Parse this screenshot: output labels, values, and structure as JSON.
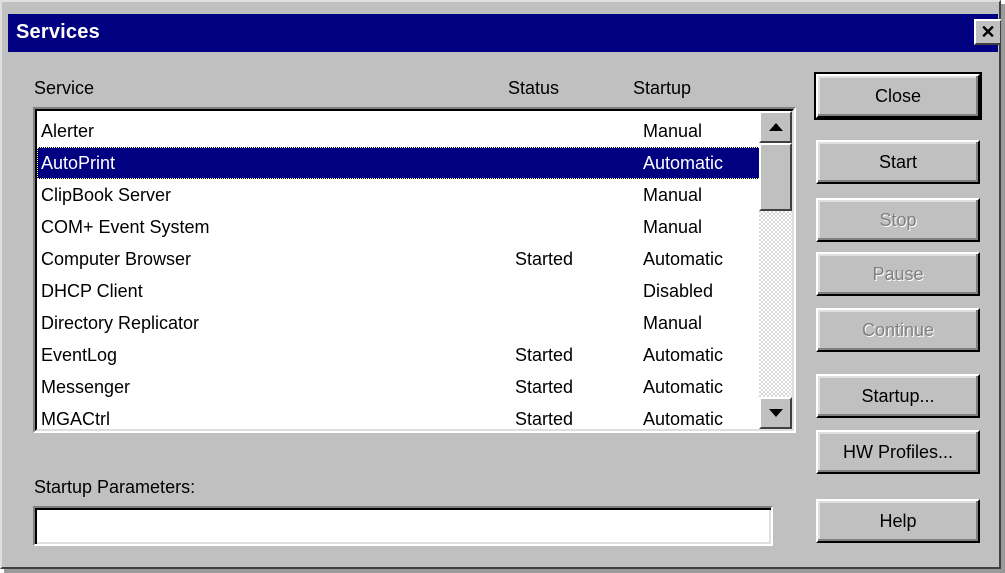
{
  "window": {
    "title": "Services",
    "close_glyph": "✕"
  },
  "list": {
    "headers": {
      "service": "Service",
      "status": "Status",
      "startup": "Startup"
    },
    "rows": [
      {
        "name": "Alerter",
        "status": "",
        "startup": "Manual",
        "selected": false
      },
      {
        "name": "AutoPrint",
        "status": "",
        "startup": "Automatic",
        "selected": true
      },
      {
        "name": "ClipBook Server",
        "status": "",
        "startup": "Manual",
        "selected": false
      },
      {
        "name": "COM+ Event System",
        "status": "",
        "startup": "Manual",
        "selected": false
      },
      {
        "name": "Computer Browser",
        "status": "Started",
        "startup": "Automatic",
        "selected": false
      },
      {
        "name": "DHCP Client",
        "status": "",
        "startup": "Disabled",
        "selected": false
      },
      {
        "name": "Directory Replicator",
        "status": "",
        "startup": "Manual",
        "selected": false
      },
      {
        "name": "EventLog",
        "status": "Started",
        "startup": "Automatic",
        "selected": false
      },
      {
        "name": "Messenger",
        "status": "Started",
        "startup": "Automatic",
        "selected": false
      },
      {
        "name": "MGACtrl",
        "status": "Started",
        "startup": "Automatic",
        "selected": false
      }
    ]
  },
  "startup_parameters": {
    "label": "Startup Parameters:",
    "value": ""
  },
  "buttons": {
    "close": "Close",
    "start": "Start",
    "stop": "Stop",
    "pause": "Pause",
    "continue": "Continue",
    "startup": "Startup...",
    "hw_profiles": "HW Profiles...",
    "help": "Help"
  },
  "colors": {
    "dialog_face": "#c0c0c0",
    "titlebar": "#000080",
    "selection": "#000080",
    "disabled_text": "#808080"
  }
}
